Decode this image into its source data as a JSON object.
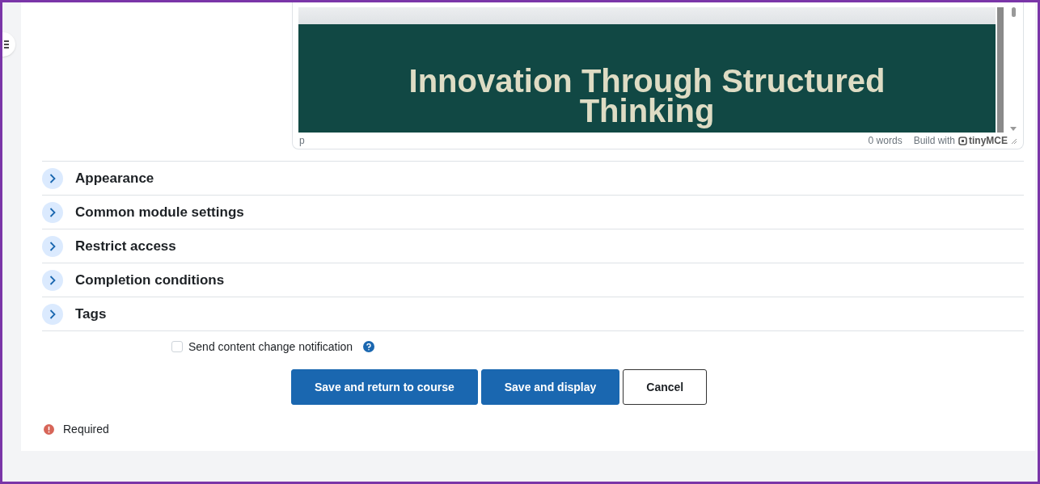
{
  "editor": {
    "slide_title": "Innovation Through Structured Thinking",
    "path": "p",
    "word_count": "0 words",
    "branding": "Build with",
    "brand_name": "tinyMCE"
  },
  "sections": [
    {
      "label": "Appearance",
      "expanded": false
    },
    {
      "label": "Common module settings",
      "expanded": false
    },
    {
      "label": "Restrict access",
      "expanded": false
    },
    {
      "label": "Completion conditions",
      "expanded": false
    },
    {
      "label": "Tags",
      "expanded": false
    }
  ],
  "notify": {
    "label": "Send content change notification",
    "checked": false
  },
  "buttons": [
    {
      "label": "Save and return to course",
      "kind": "primary"
    },
    {
      "label": "Save and display",
      "kind": "primary"
    },
    {
      "label": "Cancel",
      "kind": "secondary"
    }
  ],
  "required_note": "Required"
}
